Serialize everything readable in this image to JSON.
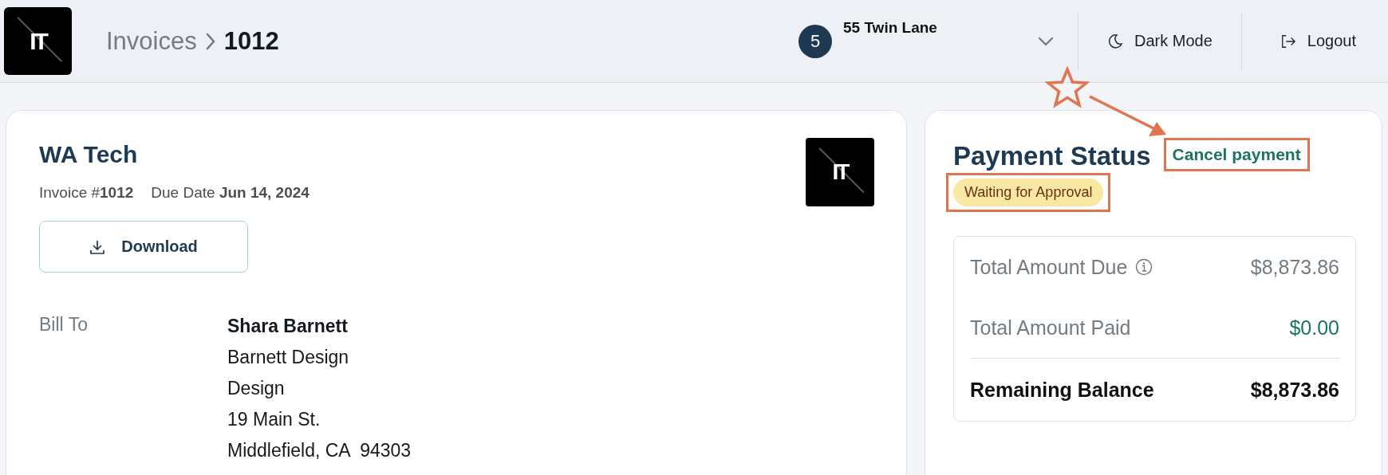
{
  "header": {
    "logo": "IT",
    "breadcrumb": [
      {
        "label": "Invoices",
        "current": false
      },
      {
        "label": "1012",
        "current": true
      }
    ],
    "property": {
      "count": "5",
      "name": "55 Twin Lane"
    },
    "dark_mode": "Dark Mode",
    "logout": "Logout"
  },
  "invoice": {
    "company": "WA Tech",
    "logo": "IT",
    "invoice_label": "Invoice #",
    "invoice_number": "1012",
    "due_label": "Due Date",
    "due_date": "Jun 14, 2024",
    "download": "Download",
    "bill_to_label": "Bill To",
    "bill_to": [
      {
        "text": "Shara Barnett",
        "kind": "name"
      },
      {
        "text": "Barnett Design",
        "kind": "line"
      },
      {
        "text": "Design",
        "kind": "line"
      },
      {
        "text": "19 Main St.",
        "kind": "line"
      },
      {
        "text": "Middlefield, CA  94303",
        "kind": "line"
      }
    ]
  },
  "payment": {
    "title": "Payment Status",
    "cancel_link": {
      "label": "Cancel payment",
      "highlighted": true,
      "starred": true
    },
    "status": {
      "label": "Waiting for Approval",
      "highlighted": true
    },
    "summary": [
      {
        "label": "Total Amount Due",
        "value": "$8,873.86",
        "kind": "due",
        "info": true
      },
      {
        "label": "Total Amount Paid",
        "value": "$0.00",
        "kind": "paid",
        "info": false
      },
      {
        "label": "Remaining Balance",
        "value": "$8,873.86",
        "kind": "total",
        "info": false
      }
    ]
  }
}
